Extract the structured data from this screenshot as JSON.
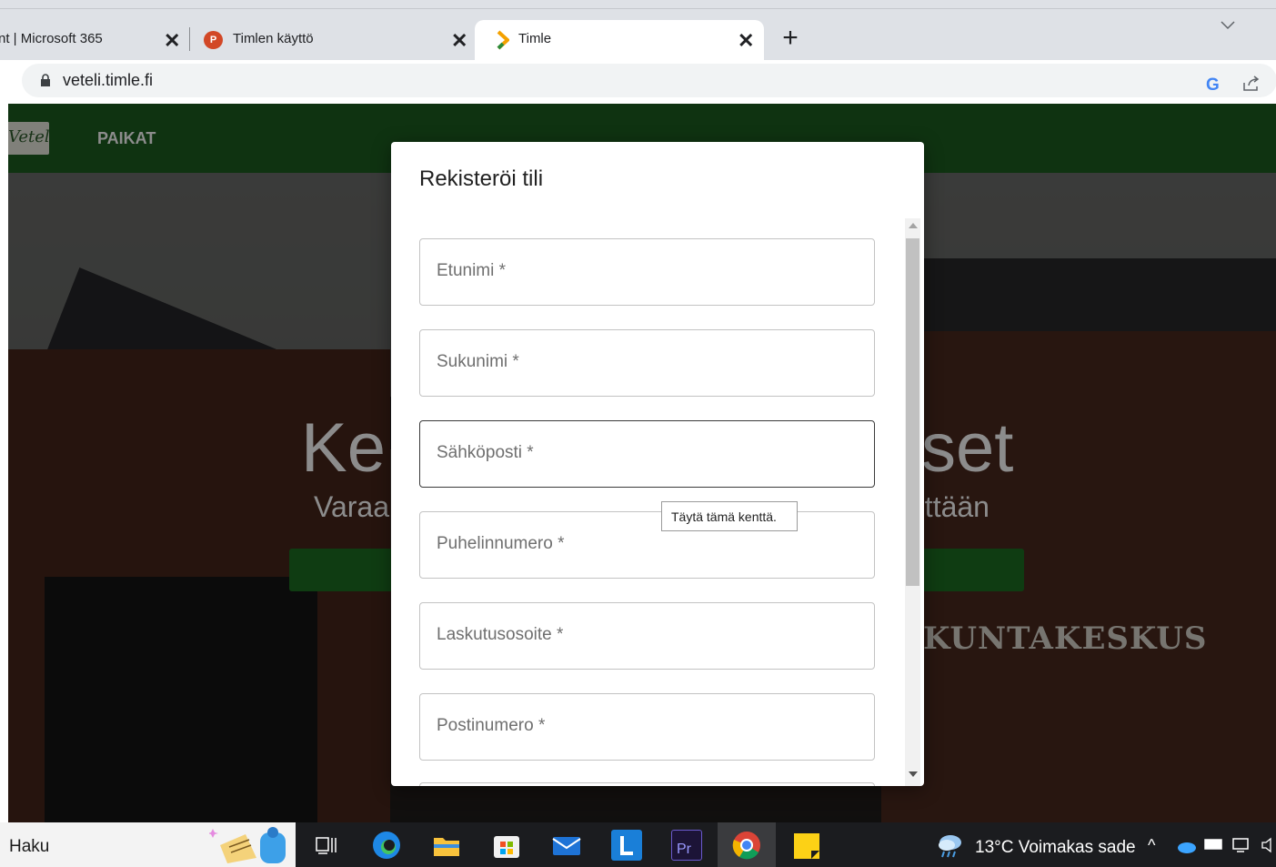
{
  "browser": {
    "tabs": [
      {
        "title": "nt | Microsoft 365",
        "close": "✕"
      },
      {
        "title": "Timlen käyttö",
        "close": "✕",
        "favicon": "powerpoint-icon"
      },
      {
        "title": "Timle",
        "close": "✕",
        "favicon": "timle-icon",
        "active": true
      }
    ],
    "new_tab": "+",
    "address": "veteli.timle.fi"
  },
  "site": {
    "nav": {
      "logo_text": "Veteli",
      "items": [
        "PAIKAT"
      ]
    },
    "hero": {
      "title_left": "Ke",
      "title_right": "set",
      "subtitle_left": "Varaa",
      "subtitle_right": "nttään",
      "sign": "KUNTAKESKUS"
    }
  },
  "modal": {
    "title": "Rekisteröi tili",
    "fields": [
      {
        "label": "Etunimi *"
      },
      {
        "label": "Sukunimi *"
      },
      {
        "label": "Sähköposti *",
        "focused": true
      },
      {
        "label": "Puhelinnumero *"
      },
      {
        "label": "Laskutusosoite *"
      },
      {
        "label": "Postinumero *"
      }
    ],
    "tooltip": "Täytä tämä kenttä."
  },
  "taskbar": {
    "search_text": "Haku",
    "weather": "13°C  Voimakas sade",
    "apps": [
      "task-view-icon",
      "edge-icon",
      "file-explorer-icon",
      "store-icon",
      "mail-icon",
      "l-app-icon",
      "premiere-icon",
      "chrome-icon",
      "sticky-notes-icon"
    ]
  },
  "colors": {
    "site_green": "#1c5e1f",
    "chrome_tabstrip": "#dee1e6",
    "taskbar": "#1b1c1f"
  }
}
